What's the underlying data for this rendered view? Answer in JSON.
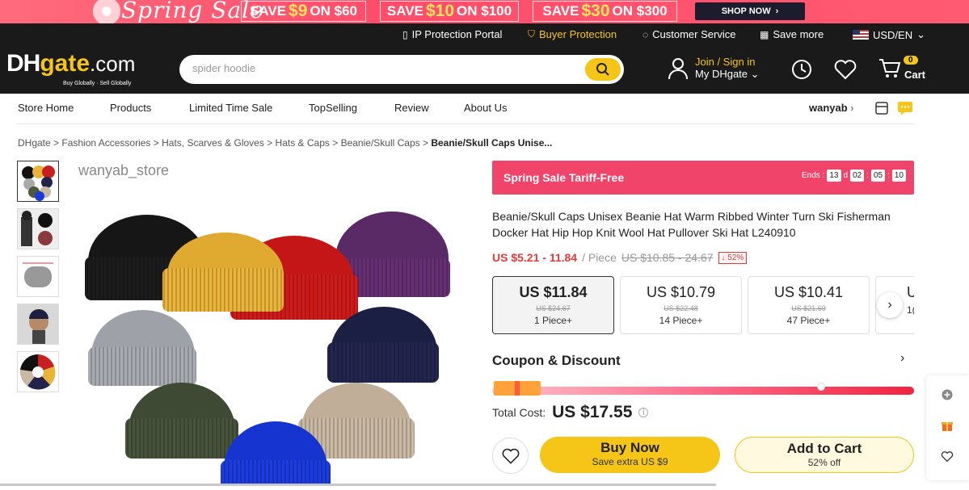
{
  "banner": {
    "title": "Spring Sale",
    "offers": [
      {
        "pre": "SAVE",
        "amount": "$9",
        "post": "ON $60"
      },
      {
        "pre": "SAVE",
        "amount": "$10",
        "post": "ON $100"
      },
      {
        "pre": "SAVE",
        "amount": "$30",
        "post": "ON $300"
      }
    ],
    "cta": "SHOP NOW"
  },
  "topbar": {
    "ip": "IP Protection Portal",
    "buyer": "Buyer Protection",
    "service": "Customer Service",
    "save": "Save more",
    "currency": "USD/EN"
  },
  "header": {
    "logo_dh": "DH",
    "logo_gate": "gate",
    "logo_com": ".com",
    "logo_tag": "Buy Globally · Sell Globally",
    "search_value": "spider hoodie",
    "join": "Join / Sign in",
    "my": "My DHgate",
    "cart_count": "0",
    "cart_label": "Cart"
  },
  "storenav": {
    "items": [
      "Store Home",
      "Products",
      "Limited Time Sale",
      "TopSelling",
      "Review",
      "About Us"
    ],
    "store": "wanyab"
  },
  "breadcrumb": {
    "items": [
      "DHgate",
      "Fashion Accessories",
      "Hats, Scarves & Gloves",
      "Hats & Caps",
      "Beanie/Skull Caps"
    ],
    "current": "Beanie/Skull Caps Unise..."
  },
  "gallery": {
    "store_name": "wanyab_store"
  },
  "promo": {
    "label": "Spring Sale Tariff-Free",
    "ends": "Ends :",
    "d": "13",
    "d_unit": "d",
    "h": "02",
    "m": "05",
    "s": "10"
  },
  "product": {
    "title": "Beanie/Skull Caps Unisex Beanie Hat Warm Ribbed Winter Turn Ski Fisherman Docker Hat Hip Hop Knit Wool Hat Pullover Ski Hat L240910",
    "price_range": "US $5.21 - 11.84",
    "unit": "/ Piece",
    "orig_range": "US $10.85 - 24.67",
    "discount": "↓ 52%"
  },
  "tiers": [
    {
      "price": "US $11.84",
      "orig": "US $24.67",
      "qty": "1 Piece+"
    },
    {
      "price": "US $10.79",
      "orig": "US $22.48",
      "qty": "14 Piece+"
    },
    {
      "price": "US $10.41",
      "orig": "US $21.69",
      "qty": "47 Piece+"
    },
    {
      "price": "U",
      "orig": "",
      "qty": "1("
    }
  ],
  "coupon": {
    "title": "Coupon & Discount",
    "progress": 0.78
  },
  "total": {
    "label": "Total Cost:",
    "amount": "US $17.55"
  },
  "buy": {
    "label": "Buy Now",
    "sub": "Save extra US $9"
  },
  "add": {
    "label": "Add to Cart",
    "sub": "52% off"
  },
  "colors": {
    "brand_yellow": "#f5c518",
    "promo_pink": "#f0446a",
    "price_red": "#e33a3a"
  }
}
